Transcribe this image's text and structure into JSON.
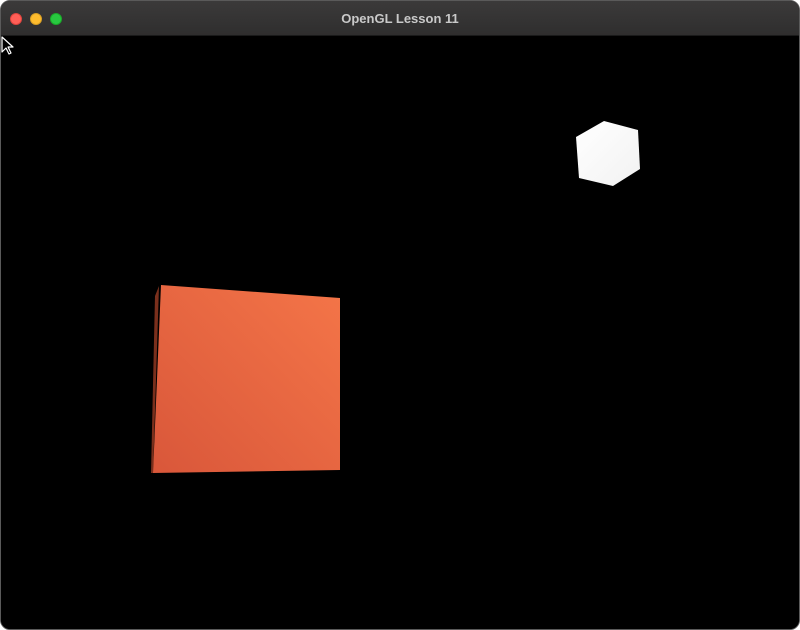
{
  "window": {
    "title": "OpenGL Lesson 11"
  },
  "scene": {
    "background_color": "#000000",
    "orange_cube_color": "#e8663f",
    "white_cube_color": "#ffffff"
  },
  "icons": {
    "close": "close-traffic-light",
    "minimize": "minimize-traffic-light",
    "zoom": "zoom-traffic-light",
    "cursor": "mouse-pointer-icon"
  }
}
